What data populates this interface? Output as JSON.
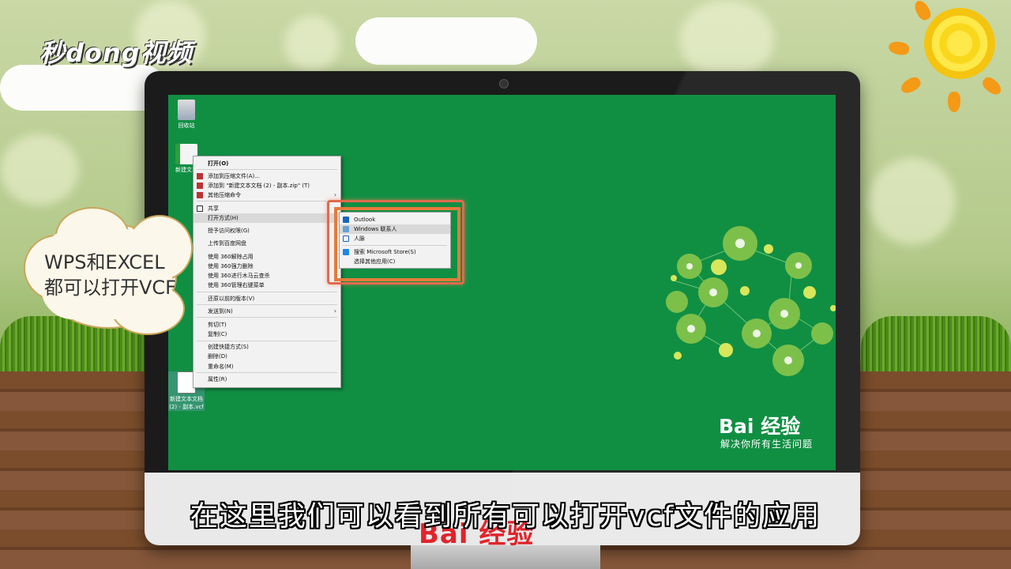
{
  "brand": {
    "logo_text": "秒dong视频"
  },
  "desktop": {
    "icons": [
      {
        "name": "recycle-bin",
        "label": "回收站"
      },
      {
        "name": "new-text-doc",
        "label": "新建文本"
      },
      {
        "name": "vcf-file",
        "label": "新建文本文档 (2) - 副本.vcf"
      }
    ]
  },
  "context_menu": {
    "items": [
      {
        "label": "打开(O)",
        "bold": true
      },
      {
        "label": "添加到压缩文件(A)..."
      },
      {
        "label": "添加到 \"新建文本文档 (2) - 副本.zip\" (T)"
      },
      {
        "label": "其他压缩命令",
        "arrow": true
      },
      {
        "label": "共享"
      },
      {
        "label": "打开方式(H)",
        "arrow": true,
        "highlight": true
      },
      {
        "label": "授予访问权限(G)",
        "arrow": true
      },
      {
        "label": "上传到百度网盘"
      },
      {
        "label": "使用 360解除占用"
      },
      {
        "label": "使用 360强力删除"
      },
      {
        "label": "使用 360进行木马云查杀"
      },
      {
        "label": "使用 360管理右键菜单"
      },
      {
        "label": "还原以前的版本(V)"
      },
      {
        "label": "发送到(N)",
        "arrow": true
      },
      {
        "label": "剪切(T)"
      },
      {
        "label": "复制(C)"
      },
      {
        "label": "创建快捷方式(S)"
      },
      {
        "label": "删除(D)"
      },
      {
        "label": "重命名(M)"
      },
      {
        "label": "属性(R)"
      }
    ]
  },
  "open_with_submenu": {
    "items": [
      {
        "label": "Outlook"
      },
      {
        "label": "Windows 联系人",
        "highlight": true
      },
      {
        "label": "人脉"
      },
      {
        "label": "搜索 Microsoft Store(S)"
      },
      {
        "label": "选择其他应用(C)"
      }
    ]
  },
  "callout": {
    "line1": "WPS和EXCEL",
    "line2": "都可以打开VCF"
  },
  "screen_brand": {
    "logo": "Bai 经验",
    "tagline": "解决你所有生活问题"
  },
  "chin_brand": {
    "logo": "Bai 经验"
  },
  "subtitle": "在这里我们可以看到所有可以打开vcf文件的应用",
  "colors": {
    "desktop_green": "#108f43",
    "highlight_outline": "#e06a4d",
    "baidu_red": "#e0242b"
  }
}
